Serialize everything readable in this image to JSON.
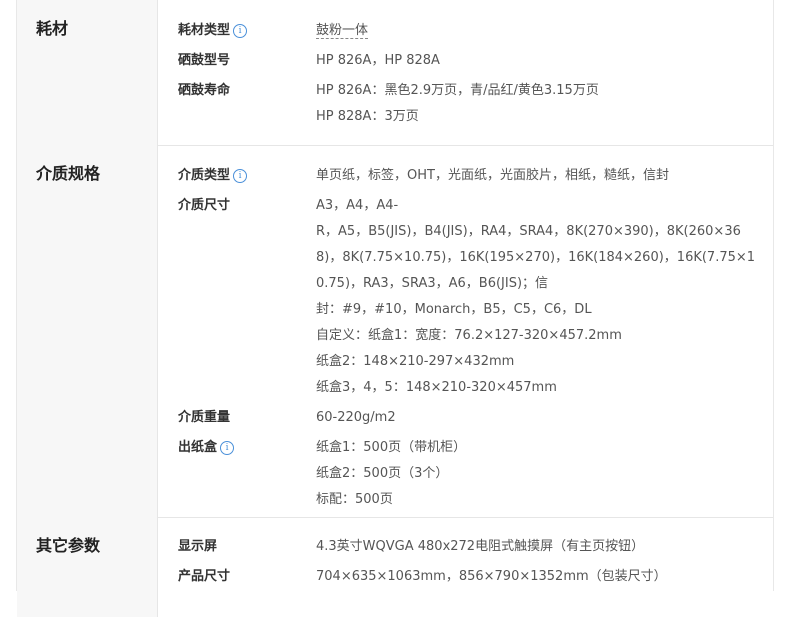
{
  "sections": [
    {
      "title": "耗材",
      "rows": [
        {
          "label": "耗材类型",
          "info": true,
          "lines": [
            "鼓粉一体"
          ]
        },
        {
          "label": "硒鼓型号",
          "info": false,
          "lines": [
            "HP 826A，HP 828A"
          ]
        },
        {
          "label": "硒鼓寿命",
          "info": false,
          "lines": [
            "HP 826A：黑色2.9万页，青/品红/黄色3.15万页",
            "HP 828A：3万页"
          ]
        }
      ]
    },
    {
      "title": "介质规格",
      "rows": [
        {
          "label": "介质类型",
          "info": true,
          "lines": [
            "单页纸，标签，OHT，光面纸，光面胶片，相纸，糙纸，信封"
          ]
        },
        {
          "label": "介质尺寸",
          "info": false,
          "lines": [
            "A3，A4，A4-",
            "R，A5，B5(JIS)，B4(JIS)，RA4，SRA4，8K(270×390)，8K(260×36",
            "8)，8K(7.75×10.75)，16K(195×270)，16K(184×260)，16K(7.75×1",
            "0.75)，RA3，SRA3，A6，B6(JIS)；信",
            "封：#9，#10，Monarch，B5，C5，C6，DL",
            "自定义：纸盒1：宽度：76.2×127-320×457.2mm",
            "纸盒2：148×210-297×432mm",
            "纸盒3，4，5：148×210-320×457mm"
          ]
        },
        {
          "label": "介质重量",
          "info": false,
          "lines": [
            "60-220g/m2"
          ]
        },
        {
          "label": "出纸盒",
          "info": true,
          "lines": [
            "纸盒1：500页（带机柜）",
            "纸盒2：500页（3个）",
            "标配：500页"
          ]
        }
      ]
    },
    {
      "title": "其它参数",
      "rows": [
        {
          "label": "显示屏",
          "info": false,
          "lines": [
            "4.3英寸WQVGA 480x272电阻式触摸屏（有主页按钮）"
          ]
        },
        {
          "label": "产品尺寸",
          "info": false,
          "lines": [
            "704×635×1063mm，856×790×1352mm（包装尺寸）"
          ]
        }
      ]
    }
  ]
}
